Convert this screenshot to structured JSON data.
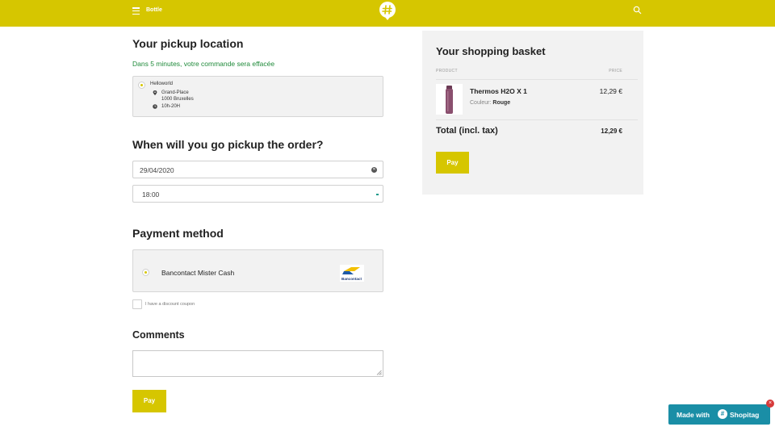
{
  "header": {
    "store_name": "Bottle",
    "menu_icon": "hamburger-icon",
    "logo_icon": "shopitag-hash-pin-icon",
    "search_icon": "search-icon",
    "bar_color": "#d6c600"
  },
  "pickup": {
    "title": "Your pickup location",
    "notice": "Dans 5 minutes, votre commande sera effacée",
    "location_name": "Helloworld",
    "address_line1": "Grand-Place",
    "address_line2": "1000 Bruxelles",
    "hours": "10h-20H"
  },
  "schedule": {
    "title": "When will you go pickup the order?",
    "date_value": "29/04/2020",
    "time_value": "18:00"
  },
  "payment": {
    "title": "Payment method",
    "method_label": "Bancontact Mister Cash",
    "method_logo_text": "Bancontact",
    "discount_label": "I have a discount coupon"
  },
  "comments": {
    "title": "Comments",
    "value": ""
  },
  "pay_button_label": "Pay",
  "basket": {
    "title": "Your shopping basket",
    "col_product": "PRODUCT",
    "col_price": "PRICE",
    "item_name": "Thermos H2O X 1",
    "item_option_label": "Couleur:",
    "item_option_value": "Rouge",
    "item_price": "12,29 €",
    "total_label": "Total (incl. tax)",
    "total_value": "12,29 €",
    "pay_label": "Pay"
  },
  "badge": {
    "made_with": "Made with",
    "brand": "Shopitag",
    "close": "×",
    "color": "#1a8ea6"
  },
  "colors": {
    "accent": "#d6c600",
    "notice_green": "#1f8a3a"
  }
}
